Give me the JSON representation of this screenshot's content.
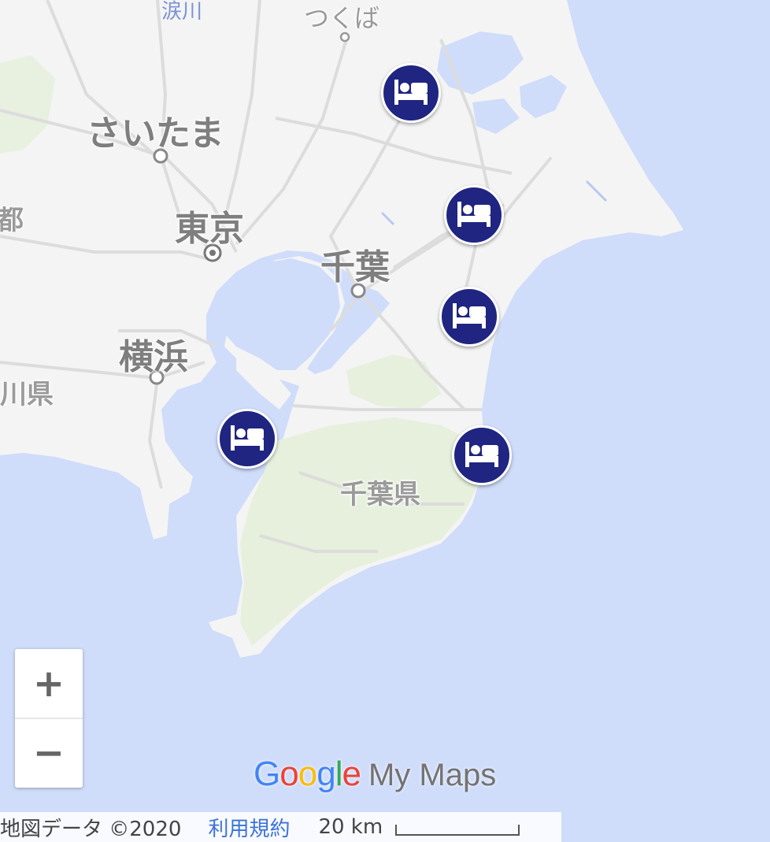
{
  "map": {
    "colors": {
      "water": "#cfdcfa",
      "land": "#f4f4f4",
      "park": "#e3efd9",
      "road": "#dddddd",
      "marker": "#1f2581"
    },
    "labels": {
      "tsukuba": "つくば",
      "saitama": "さいたま",
      "tokyo": "東京",
      "chiba": "千葉",
      "yokohama": "横浜",
      "chiba_pref": "千葉県",
      "kanagawa_partial": "川県",
      "tokyo_to_partial": "都",
      "river_partial": "涙川"
    },
    "markers": [
      {
        "icon": "hotel-bed-icon"
      },
      {
        "icon": "hotel-bed-icon"
      },
      {
        "icon": "hotel-bed-icon"
      },
      {
        "icon": "hotel-bed-icon"
      },
      {
        "icon": "hotel-bed-icon"
      }
    ]
  },
  "controls": {
    "zoom_in": "+",
    "zoom_out": "−"
  },
  "branding": {
    "google_letters": [
      "G",
      "o",
      "o",
      "g",
      "l",
      "e"
    ],
    "google_colors": [
      "#4285f4",
      "#ea4335",
      "#fbbc05",
      "#4285f4",
      "#34a853",
      "#ea4335"
    ],
    "my_maps": "My Maps"
  },
  "footer": {
    "map_data": "地図データ ©2020",
    "terms": "利用規約",
    "scale_label": "20 km"
  }
}
